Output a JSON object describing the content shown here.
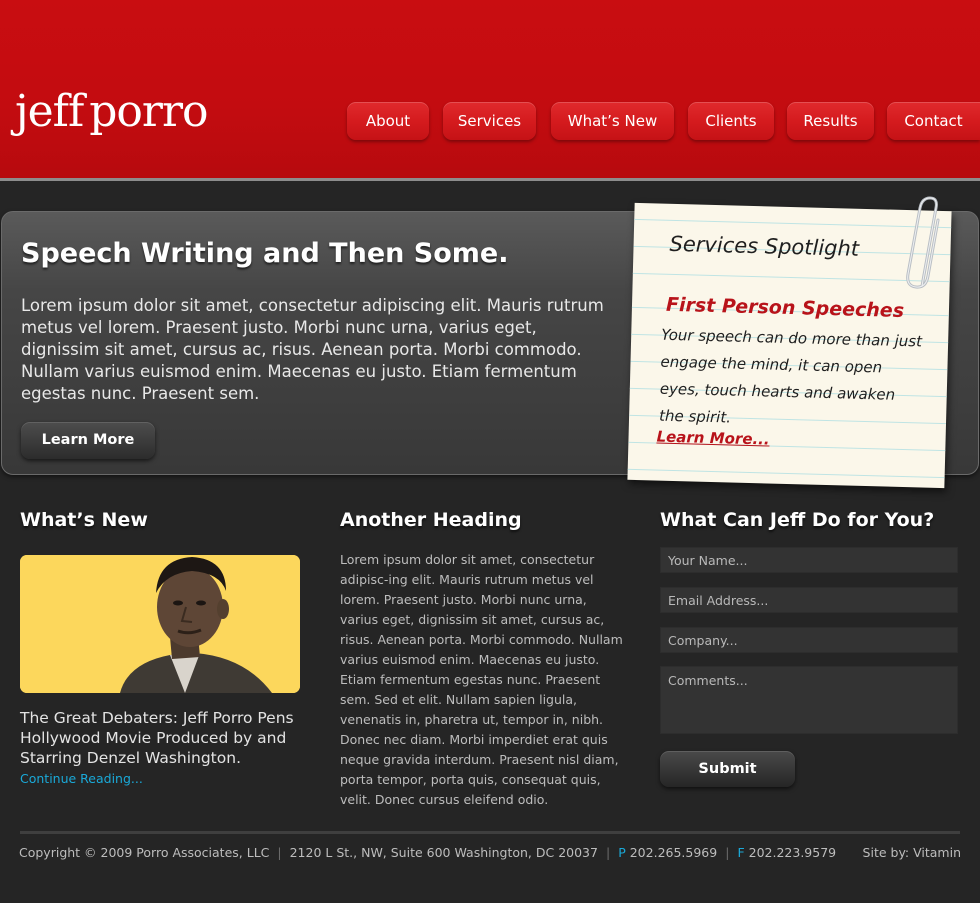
{
  "header": {
    "logo_first": "jeff",
    "logo_second": "porro",
    "nav": [
      "About",
      "Services",
      "What’s New",
      "Clients",
      "Results",
      "Contact"
    ]
  },
  "hero": {
    "title": "Speech Writing and Then Some.",
    "body": "Lorem ipsum dolor sit amet, consectetur adipiscing elit. Mauris rutrum metus vel lorem. Praesent justo. Morbi nunc urna, varius eget, dignissim sit amet, cursus ac, risus. Aenean porta. Morbi commodo. Nullam varius euismod enim. Maecenas eu justo. Etiam fermentum egestas nunc. Praesent sem.",
    "button_label": "Learn More"
  },
  "spotlight": {
    "title": "Services Spotlight",
    "subtitle": "First Person Speeches",
    "body": "Your speech can do more than just engage the mind, it can open eyes, touch hearts and awaken the spirit.",
    "link": "Learn More..."
  },
  "whats_new": {
    "heading": "What’s New",
    "caption": "The Great Debaters: Jeff Porro Pens Hollywood Movie Produced by and Starring Denzel Washington.",
    "link": "Continue Reading..."
  },
  "another": {
    "heading": "Another Heading",
    "body": "Lorem ipsum dolor sit amet, consectetur adipisc-ing elit. Mauris rutrum metus vel lorem. Praesent justo. Morbi nunc urna, varius eget, dignissim sit amet, cursus ac, risus. Aenean porta. Morbi commodo. Nullam varius euismod enim. Maecenas eu justo. Etiam fermentum egestas nunc. Praesent sem. Sed et elit. Nullam sapien ligula, venenatis in, pharetra ut, tempor in, nibh. Donec nec diam. Morbi imperdiet erat quis neque gravida interdum. Praesent nisl diam, porta tempor, porta quis, consequat quis, velit. Donec cursus eleifend odio."
  },
  "form": {
    "heading": "What Can Jeff Do for You?",
    "name_placeholder": "Your Name...",
    "email_placeholder": "Email Address...",
    "company_placeholder": "Company...",
    "comments_placeholder": "Comments...",
    "submit_label": "Submit"
  },
  "footer": {
    "copyright": "Copyright © 2009 Porro Associates, LLC",
    "address": "2120 L St., NW, Suite 600 Washington, DC 20037",
    "phone_label": "P",
    "phone": "202.265.5969",
    "fax_label": "F",
    "fax": "202.223.9579",
    "credit": "Site by: Vitamin"
  },
  "colors": {
    "brand_red": "#c90d11",
    "link_blue": "#1aa9d8",
    "note_red": "#b8131a",
    "background": "#252525"
  },
  "icons": {
    "paperclip": "paperclip-icon"
  }
}
